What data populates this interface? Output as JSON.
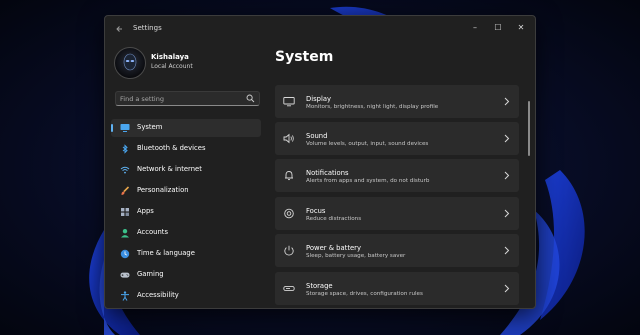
{
  "window": {
    "app_title": "Settings",
    "controls": {
      "minimize": "–",
      "maximize": "☐",
      "close": "✕"
    }
  },
  "user": {
    "name": "Kishalaya",
    "account_type": "Local Account"
  },
  "search": {
    "placeholder": "Find a setting"
  },
  "nav": {
    "items": [
      {
        "label": "System",
        "icon": "monitor-icon",
        "active": true
      },
      {
        "label": "Bluetooth & devices",
        "icon": "bluetooth-icon"
      },
      {
        "label": "Network & internet",
        "icon": "wifi-icon"
      },
      {
        "label": "Personalization",
        "icon": "brush-icon"
      },
      {
        "label": "Apps",
        "icon": "apps-icon"
      },
      {
        "label": "Accounts",
        "icon": "person-icon"
      },
      {
        "label": "Time & language",
        "icon": "globe-clock-icon"
      },
      {
        "label": "Gaming",
        "icon": "gamepad-icon"
      },
      {
        "label": "Accessibility",
        "icon": "accessibility-icon"
      }
    ]
  },
  "main": {
    "title": "System",
    "cards": [
      {
        "title": "Display",
        "description": "Monitors, brightness, night light, display profile",
        "icon": "display-icon"
      },
      {
        "title": "Sound",
        "description": "Volume levels, output, input, sound devices",
        "icon": "speaker-icon"
      },
      {
        "title": "Notifications",
        "description": "Alerts from apps and system, do not disturb",
        "icon": "bell-icon"
      },
      {
        "title": "Focus",
        "description": "Reduce distractions",
        "icon": "focus-icon"
      },
      {
        "title": "Power & battery",
        "description": "Sleep, battery usage, battery saver",
        "icon": "power-icon"
      },
      {
        "title": "Storage",
        "description": "Storage space, drives, configuration rules",
        "icon": "storage-icon"
      }
    ]
  },
  "colors": {
    "accent": "#5fb2f2",
    "window_bg": "#202020",
    "card_bg": "#2b2b2b",
    "desktop_bg": "#06091c"
  }
}
